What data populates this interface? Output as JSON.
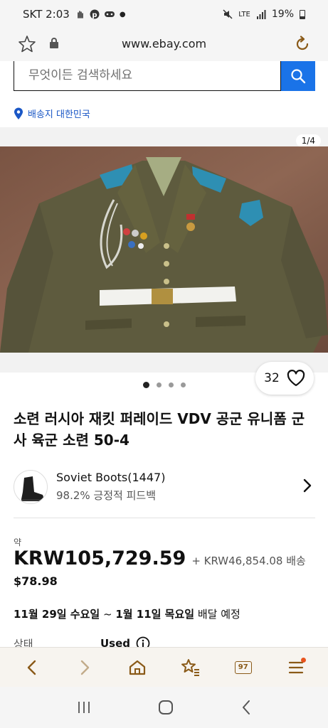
{
  "status_bar": {
    "carrier_time": "SKT 2:03",
    "network": "LTE",
    "battery": "19%"
  },
  "browser": {
    "url": "www.ebay.com"
  },
  "search": {
    "placeholder": "무엇이든 검색하세요"
  },
  "shipping_location": "배송지 대한민국",
  "gallery": {
    "counter": "1/4",
    "watch_count": "32",
    "dots": 4,
    "active_dot": 0
  },
  "listing": {
    "title": "소련 러시아 재킷 퍼레이드 VDV 공군 유니폼 군사 육군 소련 50-4"
  },
  "seller": {
    "name": "Soviet Boots(1447)",
    "feedback": "98.2% 긍정적 피드백"
  },
  "price": {
    "approx_label": "약",
    "amount": "KRW105,729.59",
    "shipping": "+ KRW46,854.08 배송",
    "usd": "$78.98"
  },
  "delivery": {
    "start": "11월 29일 수요일",
    "separator": " ~ ",
    "end": "1월 11일 목요일",
    "suffix": " 배달 예정"
  },
  "condition": {
    "label": "상태",
    "value": "Used"
  },
  "toolbar": {
    "tab_count": "97"
  },
  "colors": {
    "accent_blue": "#1a73e8",
    "link_blue": "#1a57c6",
    "toolbar_brown": "#8a5a18",
    "notification": "#e8541e"
  }
}
